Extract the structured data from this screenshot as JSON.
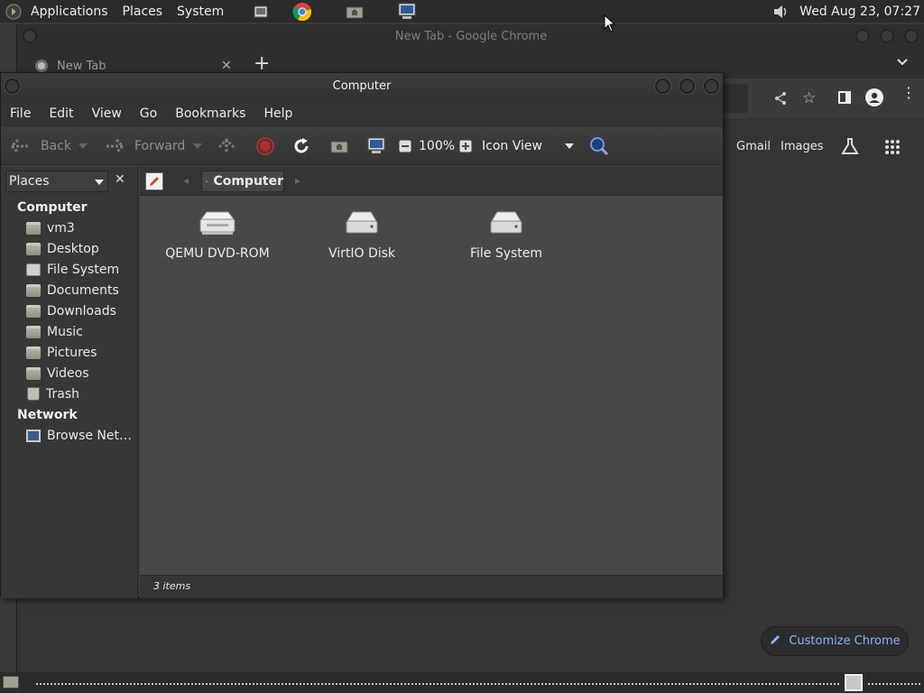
{
  "top_panel": {
    "menus": [
      "Applications",
      "Places",
      "System"
    ],
    "clock": "Wed Aug 23, 07:27"
  },
  "chrome": {
    "window_title": "New Tab - Google Chrome",
    "tab_label": "New Tab",
    "links": [
      "Gmail",
      "Images"
    ],
    "customize_label": "Customize Chrome"
  },
  "file_manager": {
    "window_title": "Computer",
    "menu": [
      "File",
      "Edit",
      "View",
      "Go",
      "Bookmarks",
      "Help"
    ],
    "toolbar": {
      "back": "Back",
      "forward": "Forward",
      "zoom": "100%",
      "view_mode": "Icon View"
    },
    "sidebar": {
      "combo_label": "Places",
      "section_computer": "Computer",
      "computer_items": [
        {
          "label": "vm3",
          "icon": "home-folder-icon"
        },
        {
          "label": "Desktop",
          "icon": "folder-icon"
        },
        {
          "label": "File System",
          "icon": "drive-icon"
        },
        {
          "label": "Documents",
          "icon": "folder-icon"
        },
        {
          "label": "Downloads",
          "icon": "folder-icon"
        },
        {
          "label": "Music",
          "icon": "folder-icon"
        },
        {
          "label": "Pictures",
          "icon": "folder-icon"
        },
        {
          "label": "Videos",
          "icon": "folder-icon"
        },
        {
          "label": "Trash",
          "icon": "trash-icon"
        }
      ],
      "section_network": "Network",
      "network_items": [
        {
          "label": "Browse Net…",
          "icon": "network-icon"
        }
      ]
    },
    "path": "Computer",
    "items": [
      {
        "label": "QEMU DVD-ROM",
        "icon": "optical-drive-icon"
      },
      {
        "label": "VirtIO Disk",
        "icon": "hard-disk-icon"
      },
      {
        "label": "File System",
        "icon": "hard-disk-icon"
      }
    ],
    "status": "3 items"
  }
}
